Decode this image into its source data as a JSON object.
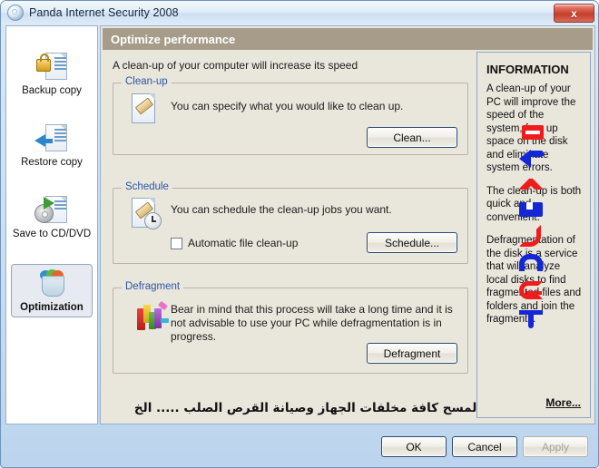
{
  "window": {
    "title": "Panda Internet Security 2008",
    "app_icon": "panda-logo-icon",
    "close_label": "x"
  },
  "sidebar": {
    "items": [
      {
        "label": "Backup copy",
        "icon": "document-lock-icon",
        "selected": false
      },
      {
        "label": "Restore copy",
        "icon": "document-restore-arrow-icon",
        "selected": false
      },
      {
        "label": "Save to CD/DVD",
        "icon": "cd-dvd-save-icon",
        "selected": false
      },
      {
        "label": "Optimization",
        "icon": "recycle-bin-icon",
        "selected": true
      }
    ]
  },
  "main": {
    "header": "Optimize performance",
    "subtitle": "A clean-up of your computer will increase its speed",
    "groups": [
      {
        "title": "Clean-up",
        "icon": "page-eraser-icon",
        "description": "You can specify what you would like to clean up.",
        "button": "Clean..."
      },
      {
        "title": "Schedule",
        "icon": "page-eraser-clock-icon",
        "description": "You can schedule the clean-up jobs you want.",
        "checkbox_label": "Automatic file clean-up",
        "checkbox_checked": false,
        "button": "Schedule..."
      },
      {
        "title": "Defragment",
        "icon": "defragment-blocks-icon",
        "description": "Bear in mind that this process will take a long time and it is not advisable to use your PC while defragmentation is in progress.",
        "button": "Defragment"
      }
    ],
    "arabic_note": "هنا كما ذكرت لمسح كافة مخلفات الجهاز وصيانة القرص الصلب ..... الخ"
  },
  "info_panel": {
    "title": "INFORMATION",
    "paragraphs": [
      "A clean-up of your PC will improve the speed of the system, free up space on the disk and eliminate system errors.",
      "The clean-up is both quick and convenient.",
      "Defragmentation of the disk is a service that will analyze local disks to find fragmented files and folders and join the fragments."
    ],
    "more_link": "More...",
    "annotation_glyphs": [
      {
        "name": "red-bar-glyph",
        "color": "#ee1c1c"
      },
      {
        "name": "blue-arrow-flag-glyph",
        "color": "#1427d6"
      },
      {
        "name": "red-caret-up-glyph",
        "color": "#ee1c1c"
      },
      {
        "name": "blue-block-glyph",
        "color": "#1427d6"
      },
      {
        "name": "red-hook-glyph",
        "color": "#ee1c1c"
      },
      {
        "name": "blue-arch-glyph",
        "color": "#1427d6"
      },
      {
        "name": "red-subset-glyph",
        "color": "#ee1c1c"
      },
      {
        "name": "blue-tee-glyph",
        "color": "#1427d6"
      }
    ]
  },
  "footer": {
    "ok": "OK",
    "cancel": "Cancel",
    "apply": "Apply",
    "apply_enabled": false
  },
  "colors": {
    "header_bar": "#a79c8a",
    "panel_bg": "#e9e6dc",
    "group_title": "#2b56a8",
    "annotation_red": "#ee1c1c",
    "annotation_blue": "#1427d6"
  }
}
